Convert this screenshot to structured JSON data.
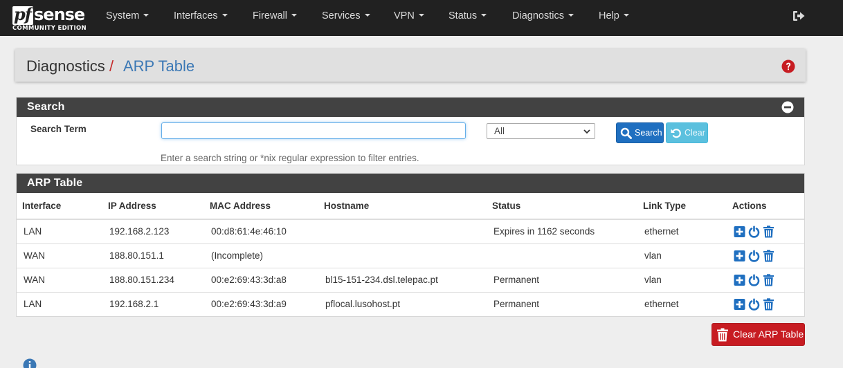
{
  "navbar": {
    "logo": {
      "brand_prefix": "pf",
      "brand_suffix": "sense",
      "edition": "COMMUNITY EDITION"
    },
    "menu": [
      {
        "label": "System"
      },
      {
        "label": "Interfaces"
      },
      {
        "label": "Firewall"
      },
      {
        "label": "Services"
      },
      {
        "label": "VPN"
      },
      {
        "label": "Status"
      },
      {
        "label": "Diagnostics"
      },
      {
        "label": "Help"
      }
    ],
    "logout_icon": "sign-out-icon"
  },
  "breadcrumb": {
    "section": "Diagnostics",
    "separator": "/",
    "page": "ARP Table"
  },
  "help_icon": "question-circle-icon",
  "search_panel": {
    "title": "Search",
    "label": "Search Term",
    "input_value": "",
    "select_value": "All",
    "search_button": "Search",
    "clear_button": "Clear",
    "help_text": "Enter a search string or *nix regular expression to filter entries."
  },
  "arp_panel": {
    "title": "ARP Table",
    "columns": [
      "Interface",
      "IP Address",
      "MAC Address",
      "Hostname",
      "Status",
      "Link Type",
      "Actions"
    ],
    "rows": [
      {
        "interface": "LAN",
        "ip": "192.168.2.123",
        "mac": "00:d8:61:4e:46:10",
        "hostname": "",
        "status": "Expires in 1162 seconds",
        "link": "ethernet"
      },
      {
        "interface": "WAN",
        "ip": "188.80.151.1",
        "mac": "(Incomplete)",
        "hostname": "",
        "status": "",
        "link": "vlan"
      },
      {
        "interface": "WAN",
        "ip": "188.80.151.234",
        "mac": "00:e2:69:43:3d:a8",
        "hostname": "bl15-151-234.dsl.telepac.pt",
        "status": "Permanent",
        "link": "vlan"
      },
      {
        "interface": "LAN",
        "ip": "192.168.2.1",
        "mac": "00:e2:69:43:3d:a9",
        "hostname": "pflocal.lusohost.pt",
        "status": "Permanent",
        "link": "ethernet"
      }
    ],
    "action_icons": [
      "plus-square-icon",
      "power-off-icon",
      "trash-icon"
    ]
  },
  "clear_arp_button": "Clear ARP Table",
  "colors": {
    "navbar": "#212121",
    "link": "#3b78b5",
    "danger": "#c71c22",
    "primary": "#1f6fc0",
    "info": "#5bc0de"
  }
}
